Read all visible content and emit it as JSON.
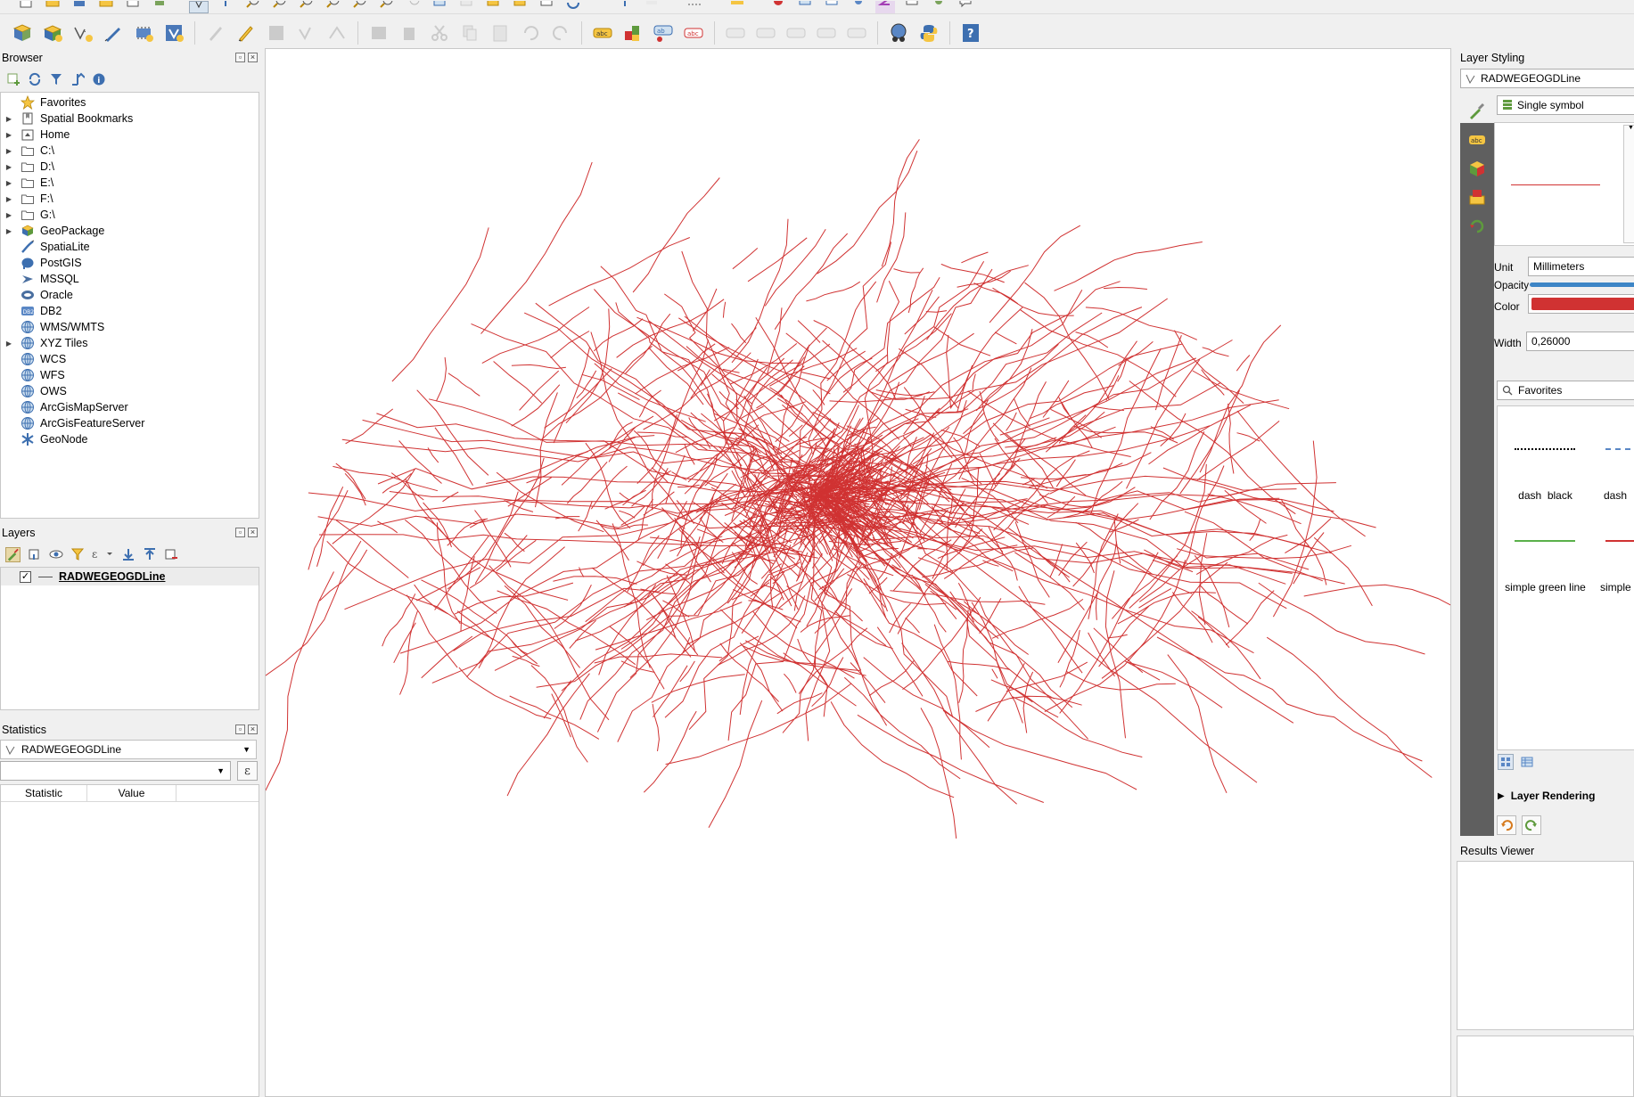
{
  "browser": {
    "title": "Browser",
    "items": [
      {
        "label": "Favorites",
        "expand": false,
        "icon": "star-icon"
      },
      {
        "label": "Spatial Bookmarks",
        "expand": true,
        "icon": "bookmark-icon"
      },
      {
        "label": "Home",
        "expand": true,
        "icon": "home-folder-icon"
      },
      {
        "label": "C:\\",
        "expand": true,
        "icon": "folder-icon"
      },
      {
        "label": "D:\\",
        "expand": true,
        "icon": "folder-icon"
      },
      {
        "label": "E:\\",
        "expand": true,
        "icon": "folder-icon"
      },
      {
        "label": "F:\\",
        "expand": true,
        "icon": "folder-icon"
      },
      {
        "label": "G:\\",
        "expand": true,
        "icon": "folder-icon"
      },
      {
        "label": "GeoPackage",
        "expand": true,
        "icon": "geopackage-icon"
      },
      {
        "label": "SpatiaLite",
        "expand": false,
        "icon": "spatialite-icon"
      },
      {
        "label": "PostGIS",
        "expand": false,
        "icon": "postgis-elephant-icon"
      },
      {
        "label": "MSSQL",
        "expand": false,
        "icon": "mssql-icon"
      },
      {
        "label": "Oracle",
        "expand": false,
        "icon": "oracle-icon"
      },
      {
        "label": "DB2",
        "expand": false,
        "icon": "db2-icon"
      },
      {
        "label": "WMS/WMTS",
        "expand": false,
        "icon": "globe-icon"
      },
      {
        "label": "XYZ Tiles",
        "expand": true,
        "icon": "globe-icon"
      },
      {
        "label": "WCS",
        "expand": false,
        "icon": "globe-icon"
      },
      {
        "label": "WFS",
        "expand": false,
        "icon": "globe-icon"
      },
      {
        "label": "OWS",
        "expand": false,
        "icon": "globe-icon"
      },
      {
        "label": "ArcGisMapServer",
        "expand": false,
        "icon": "globe-icon"
      },
      {
        "label": "ArcGisFeatureServer",
        "expand": false,
        "icon": "globe-icon"
      },
      {
        "label": "GeoNode",
        "expand": false,
        "icon": "geonode-icon"
      }
    ]
  },
  "layers": {
    "title": "Layers",
    "items": [
      {
        "label": "RADWEGEOGDLine",
        "checked": true
      }
    ]
  },
  "statistics": {
    "title": "Statistics",
    "layer": "RADWEGEOGDLine",
    "col_statistic": "Statistic",
    "col_value": "Value"
  },
  "styling": {
    "title": "Layer Styling",
    "layer": "RADWEGEOGDLine",
    "renderer": "Single symbol",
    "unit_label": "Unit",
    "unit_value": "Millimeters",
    "opacity_label": "Opacity",
    "color_label": "Color",
    "color_value": "#d03232",
    "width_label": "Width",
    "width_value": "0,26000",
    "search_value": "Favorites",
    "symbols": [
      {
        "label": "dash  black",
        "kind": "dash-black"
      },
      {
        "label": "dash",
        "kind": "dash-blue"
      },
      {
        "label": "simple green line",
        "kind": "green"
      },
      {
        "label": "simple",
        "kind": "red"
      }
    ],
    "layer_rendering": "Layer Rendering"
  },
  "results": {
    "title": "Results Viewer"
  },
  "map": {
    "line_color": "#d03232"
  }
}
